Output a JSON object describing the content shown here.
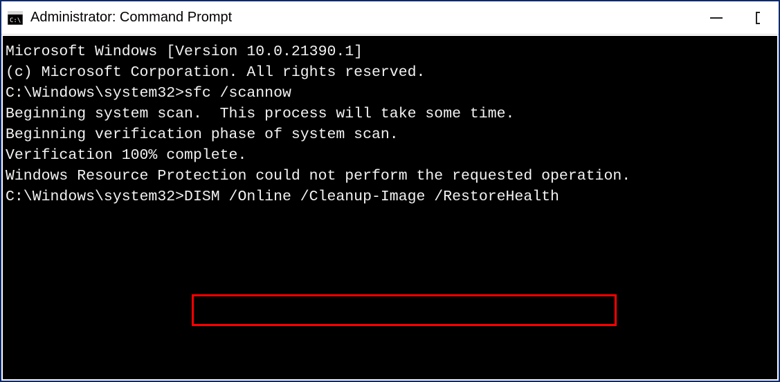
{
  "window": {
    "title": "Administrator: Command Prompt"
  },
  "terminal": {
    "line1": "Microsoft Windows [Version 10.0.21390.1]",
    "line2": "(c) Microsoft Corporation. All rights reserved.",
    "blank1": "",
    "prompt1_path": "C:\\Windows\\system32>",
    "prompt1_cmd": "sfc /scannow",
    "blank2": "",
    "line3": "Beginning system scan.  This process will take some time.",
    "blank3": "",
    "line4": "Beginning verification phase of system scan.",
    "line5": "Verification 100% complete.",
    "blank4": "",
    "line6": "Windows Resource Protection could not perform the requested operation.",
    "blank5": "",
    "prompt2_path": "C:\\Windows\\system32>",
    "prompt2_cmd": "DISM /Online /Cleanup-Image /RestoreHealth"
  }
}
